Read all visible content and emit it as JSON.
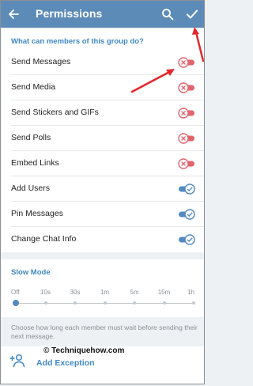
{
  "header": {
    "title": "Permissions",
    "bg_color": "#5d8bb8"
  },
  "permissions": {
    "section_title": "What can members of this group do?",
    "items": [
      {
        "label": "Send Messages",
        "enabled": false
      },
      {
        "label": "Send Media",
        "enabled": false
      },
      {
        "label": "Send Stickers and GIFs",
        "enabled": false
      },
      {
        "label": "Send Polls",
        "enabled": false
      },
      {
        "label": "Embed Links",
        "enabled": false
      },
      {
        "label": "Add Users",
        "enabled": true
      },
      {
        "label": "Pin Messages",
        "enabled": true
      },
      {
        "label": "Change Chat Info",
        "enabled": true
      }
    ]
  },
  "slow_mode": {
    "title": "Slow Mode",
    "options": [
      "Off",
      "10s",
      "30s",
      "1m",
      "5m",
      "15m",
      "1h"
    ],
    "selected": "Off",
    "description": "Choose how long each member must wait before sending their next message."
  },
  "exception": {
    "label": "Add Exception",
    "icon": "add-user-icon"
  },
  "watermark": "© Techniquehow.com",
  "colors": {
    "accent": "#3f88c5",
    "toggle_on": "#5289c2",
    "toggle_off": "#e0656c",
    "annotation": "#e5262b"
  }
}
